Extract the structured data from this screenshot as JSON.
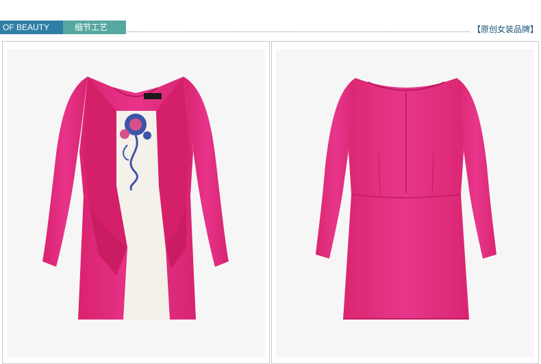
{
  "header": {
    "brand_tag": "OF BEAUTY",
    "section_tag": "细节工艺",
    "brand_note": "【原创女装品牌】"
  },
  "photos": {
    "front": {
      "label_icon": "dress-front-view-icon"
    },
    "back": {
      "label_icon": "dress-back-view-icon"
    }
  },
  "colors": {
    "brand_blue": "#2f7fa4",
    "section_teal": "#57a7a1",
    "dress_pink": "#e0297a",
    "panel_ivory": "#f4f0ea",
    "embroidery_blue": "#3b55a8",
    "embroidery_pink": "#d5508c"
  }
}
